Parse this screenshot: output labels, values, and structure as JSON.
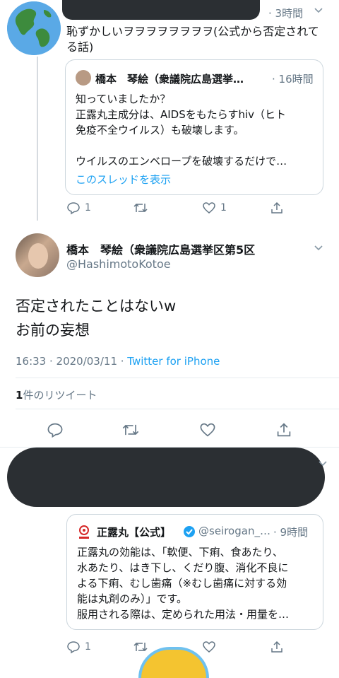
{
  "tweet1": {
    "time": "3時間",
    "text_line1": "恥ずかしいヲヲヲヲヲヲヲヲ(公式から否定されて",
    "text_line2": "る話)",
    "quote": {
      "name": "橋本　琴絵（衆議院広島選挙…",
      "time": "16時間",
      "line1": "知っていましたか？",
      "line2": "正露丸主成分は、AIDSをもたらすhiv（ヒト",
      "line3": "免疫不全ウイルス）も破壊します。",
      "line4": "ウイルスのエンベロープを破壊するだけで…",
      "show_thread": "このスレッドを表示"
    },
    "reply_count": "1",
    "like_count": "1"
  },
  "main_tweet": {
    "name": "橋本　琴絵（衆議院広島選挙区第5区",
    "handle": "@HashimotoKotoe",
    "text_line1": "否定されたことはないw",
    "text_line2": "お前の妄想",
    "timestamp": "16:33 · 2020/03/11 · ",
    "source": "Twitter for iPhone",
    "retweet_count": "1",
    "retweet_label": "件のリツイート"
  },
  "tweet3": {
    "quote": {
      "name": "正露丸【公式】",
      "handle": "@seirogan_…",
      "time": "9時間",
      "line1": "正露丸の効能は、「軟便、下痢、食あたり、",
      "line2": "水あたり、はき下し、くだり腹、消化不良に",
      "line3": "よる下痢、むし歯痛（※むし歯痛に対する効",
      "line4": "能は丸剤のみ）」です。",
      "line5": "服用される際は、定められた用法・用量を…"
    },
    "reply_count": "1"
  },
  "colors": {
    "accent": "#1da1f2",
    "muted": "#657786",
    "border": "#e6ecf0",
    "verified": "#1da1f2"
  },
  "icons": [
    "globe-icon",
    "chevron-down-icon",
    "reply-icon",
    "retweet-icon",
    "like-icon",
    "share-icon",
    "verified-icon"
  ]
}
